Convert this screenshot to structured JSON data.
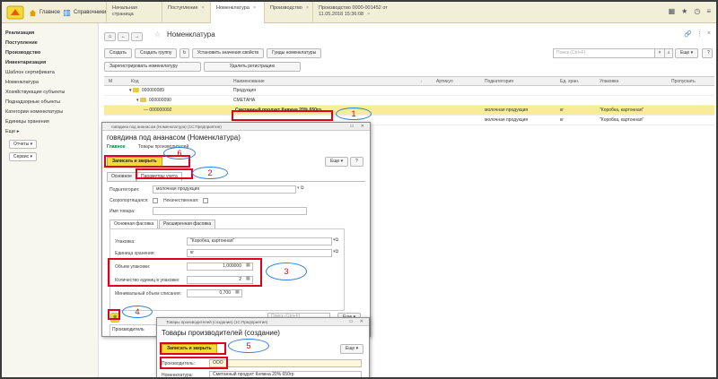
{
  "topbar": {
    "sections": [
      {
        "label": "Главное",
        "icon": "home-icon"
      },
      {
        "label": "Справочники",
        "icon": "grid-icon"
      }
    ],
    "tabs": [
      {
        "label": "Начальная страница"
      },
      {
        "label": "Поступление"
      },
      {
        "label": "Номенклатура",
        "active": true
      },
      {
        "label": "Производство"
      },
      {
        "label": "Производство 0000-001452 от 11.05.2018 15:36:08"
      }
    ],
    "icons": [
      "apps-icon",
      "star-icon",
      "history-icon",
      "menu-icon"
    ]
  },
  "sidebar": {
    "items": [
      {
        "label": "Реализация",
        "bold": true
      },
      {
        "label": "Поступление",
        "bold": true
      },
      {
        "label": "Производство",
        "bold": true
      },
      {
        "label": "Инвентаризация",
        "bold": true
      },
      {
        "label": "Шаблон сертификата"
      },
      {
        "label": "Номенклатура"
      },
      {
        "label": "Хозяйствующие субъекты"
      },
      {
        "label": "Поднадзорные объекты"
      },
      {
        "label": "Категории номенклатуры"
      },
      {
        "label": "Единицы хранения"
      },
      {
        "label": "Еще"
      }
    ],
    "buttons": [
      "Отчеты ▾",
      "Сервис ▾"
    ]
  },
  "main": {
    "title": "Номенклатура",
    "toolbar1": [
      "Создать",
      "Создать группу",
      "Установить значения свойств",
      "Гуиды номенклатуры"
    ],
    "toolbar2": [
      "Зарегистрировать номенклатуру",
      "Удалить регистрацию"
    ],
    "search_placeholder": "Поиск (Ctrl+F)",
    "more": "Еще ▾",
    "help": "?",
    "columns": [
      "М",
      "Код",
      "Наименование",
      "Артикул",
      "Подкатегория",
      "Ед. хран.",
      "Упаковка",
      "Пропускать"
    ],
    "rows": [
      {
        "code": "000000089",
        "name": "Продукция",
        "sub": "",
        "unit": "",
        "pack": ""
      },
      {
        "code": "000000090",
        "name": "СМЕТАНА",
        "sub": "",
        "unit": "",
        "pack": ""
      },
      {
        "code": "000000092",
        "name": "Сметанный продукт Княжна 20% 650гр",
        "sub": "молочная продукция",
        "unit": "кг",
        "pack": "\"Коробка, картонная\""
      },
      {
        "code": "",
        "name": "",
        "sub": "молочная продукция",
        "unit": "кг",
        "pack": "\"Коробка, картонная\""
      }
    ]
  },
  "dialog1": {
    "window_title": "говядина под ананасом (Номенклатура) (1С:Предприятие)",
    "heading": "говядина под ананасом (Номенклатура)",
    "links": [
      "Главное",
      "Товары производителей"
    ],
    "save_close": "Записать и закрыть",
    "more": "Еще ▾",
    "help": "?",
    "tabs": [
      "Основное",
      "Параметры учета"
    ],
    "subcategory_label": "Подкатегория:",
    "subcategory_value": "молочная продукция",
    "perishable_label": "Скоропортящаяся:",
    "incomplete_label": "Некачественная:",
    "product_name_label": "Имя товара:",
    "inner_tabs": [
      "Основная фасовка",
      "Расширенная фасовка"
    ],
    "package_label": "Упаковка:",
    "package_value": "\"Коробка, картонная\"",
    "unit_label": "Единица хранения:",
    "unit_value": "кг",
    "volume_label": "Объем упаковки:",
    "volume_value": "1,000000",
    "count_label": "Количество единиц в упаковке:",
    "count_value": "2",
    "min_label": "Минимальный объем списания:",
    "min_value": "0,700",
    "search_placeholder": "Поиск (Ctrl+F)",
    "more2": "Еще ▾",
    "col_producer": "Производитель"
  },
  "dialog2": {
    "window_title": "Товары производителей (создание) (1С:Предприятие)",
    "heading": "Товары производителей (создание)",
    "save_close": "Записать и закрыть",
    "more": "Еще ▾",
    "producer_label": "Производитель:",
    "producer_value": "ООО",
    "nomen_label": "Номенклатура:",
    "nomen_value": "Сметанный продукт Княжна 20% 650гр"
  },
  "annotations": [
    "1",
    "2",
    "3",
    "4",
    "5",
    "6"
  ],
  "colors": {
    "highlight": "#f8eb9a",
    "red": "#e0001b",
    "blue": "#2f7fd8",
    "yellow_button": "#f5d93b",
    "topbar": "#f2efd8"
  }
}
